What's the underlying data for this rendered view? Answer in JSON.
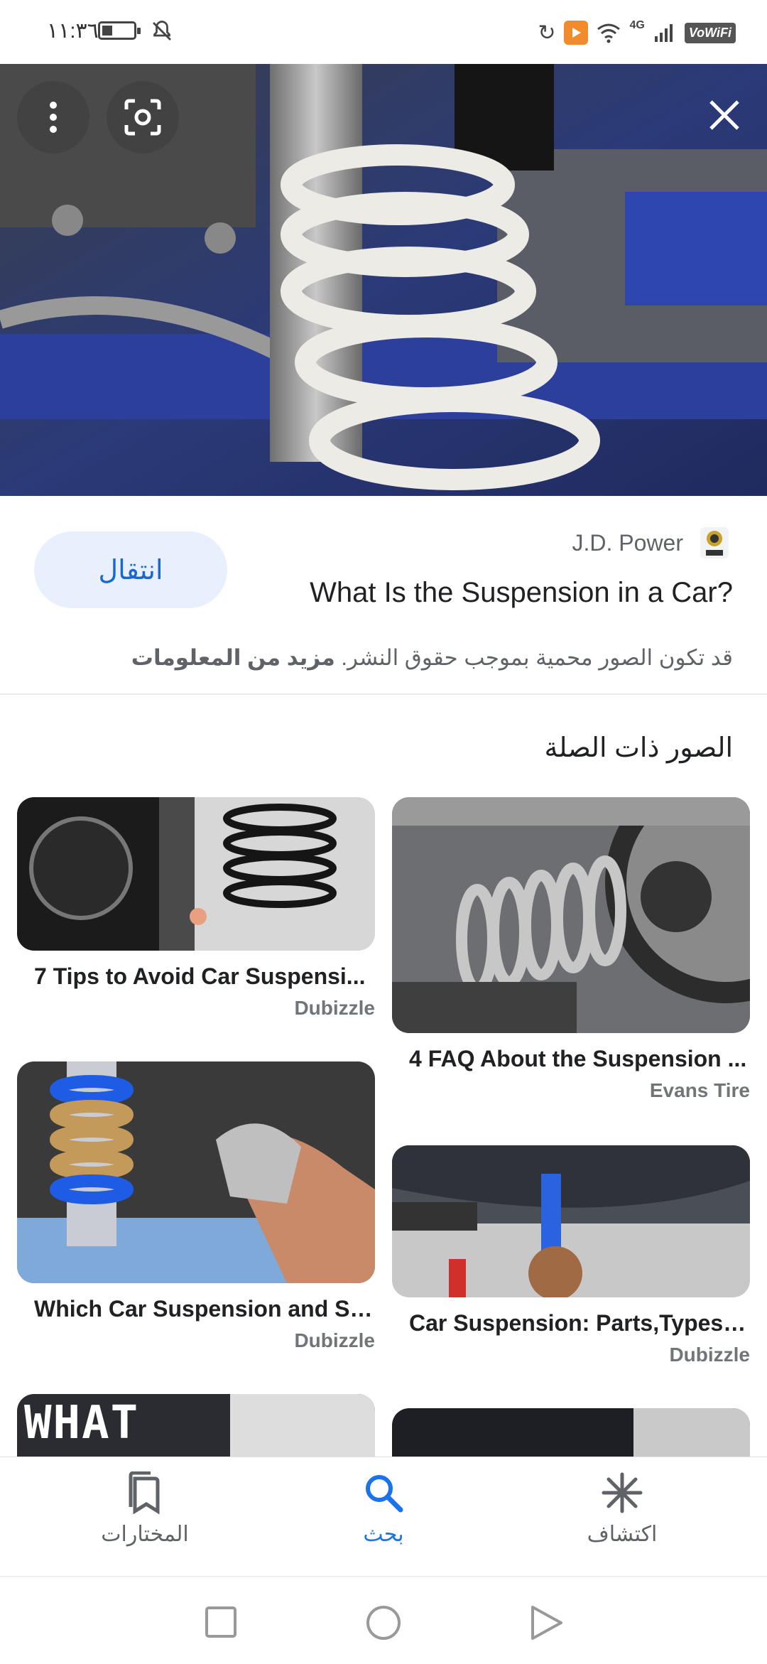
{
  "status_bar": {
    "time": "١١:٣٦",
    "network": "4G",
    "vowifi": "VoWiFi"
  },
  "hero": {
    "menu_icon": "more-vert-icon",
    "lens_icon": "lens-icon",
    "close_icon": "close-icon"
  },
  "result": {
    "source": "J.D. Power",
    "title": "What Is the Suspension in a Car?",
    "visit_label": "انتقال",
    "copyright_text": "قد تكون الصور محمية بموجب حقوق النشر.",
    "more_info": "مزيد من المعلومات"
  },
  "related": {
    "heading": "الصور ذات الصلة",
    "items": [
      {
        "caption": "7 Tips to Avoid Car Suspensi...",
        "source": "Dubizzle"
      },
      {
        "caption": "4 FAQ About the Suspension ...",
        "source": "Evans Tire"
      },
      {
        "caption": "Which Car Suspension and St...",
        "source": "Dubizzle"
      },
      {
        "caption": "Car Suspension: Parts,Types, ...",
        "source": "Dubizzle"
      },
      {
        "overlay_text": "WHAT"
      }
    ]
  },
  "bottom_nav": {
    "items": [
      {
        "label": "المختارات",
        "icon": "bookmarks-icon"
      },
      {
        "label": "بحث",
        "icon": "search-icon"
      },
      {
        "label": "اكتشاف",
        "icon": "asterisk-icon"
      }
    ],
    "active_index": 1
  },
  "colors": {
    "accent": "#1a73e8",
    "visit_bg": "#e8f0fe",
    "visit_text": "#1967d2"
  }
}
